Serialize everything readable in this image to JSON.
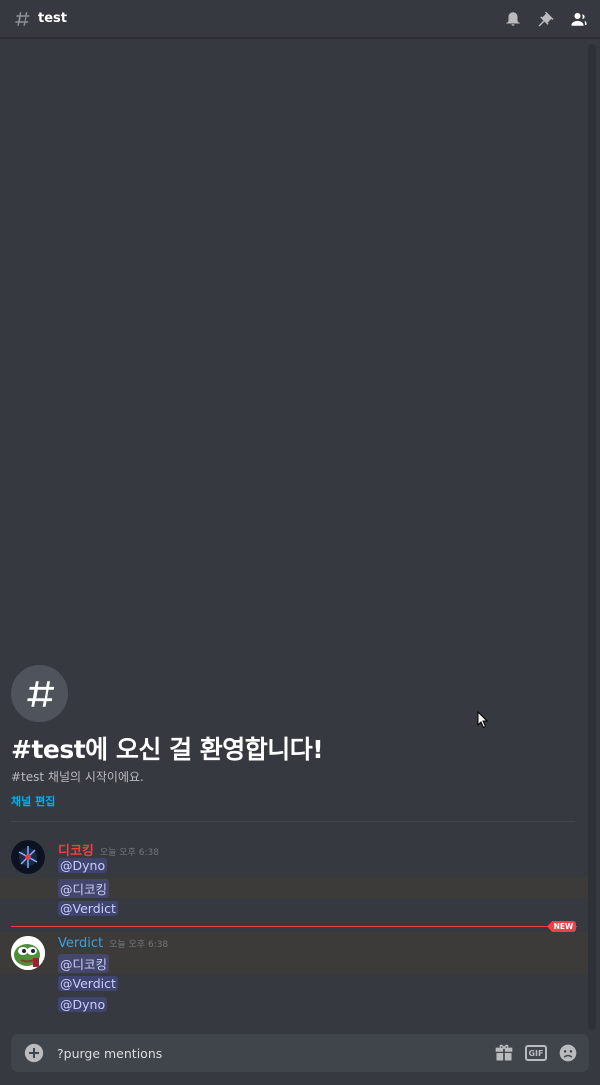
{
  "header": {
    "channel_name": "test",
    "icons": [
      "bell-icon",
      "pin-icon",
      "members-icon"
    ]
  },
  "welcome": {
    "title": "#test에 오신 걸 환영합니다!",
    "subtitle": "#test 채널의 시작이에요.",
    "edit_link": "채널 편집"
  },
  "messages": [
    {
      "author": "디코킹",
      "author_color": "#ed4245",
      "timestamp": "오늘 오후 6:38",
      "lines": [
        "@Dyno",
        "@디코킹",
        "@Verdict"
      ]
    },
    {
      "author": "Verdict",
      "author_color": "#3ba0e0",
      "timestamp": "오늘 오후 6:38",
      "lines": [
        "@디코킹",
        "@Verdict",
        "@Dyno"
      ]
    }
  ],
  "new_badge": "NEW",
  "composer": {
    "value": "?purge mentions",
    "gif_label": "GIF"
  },
  "colors": {
    "background": "#36393f",
    "accent_link": "#00aff4",
    "new_red": "#ed4245"
  }
}
